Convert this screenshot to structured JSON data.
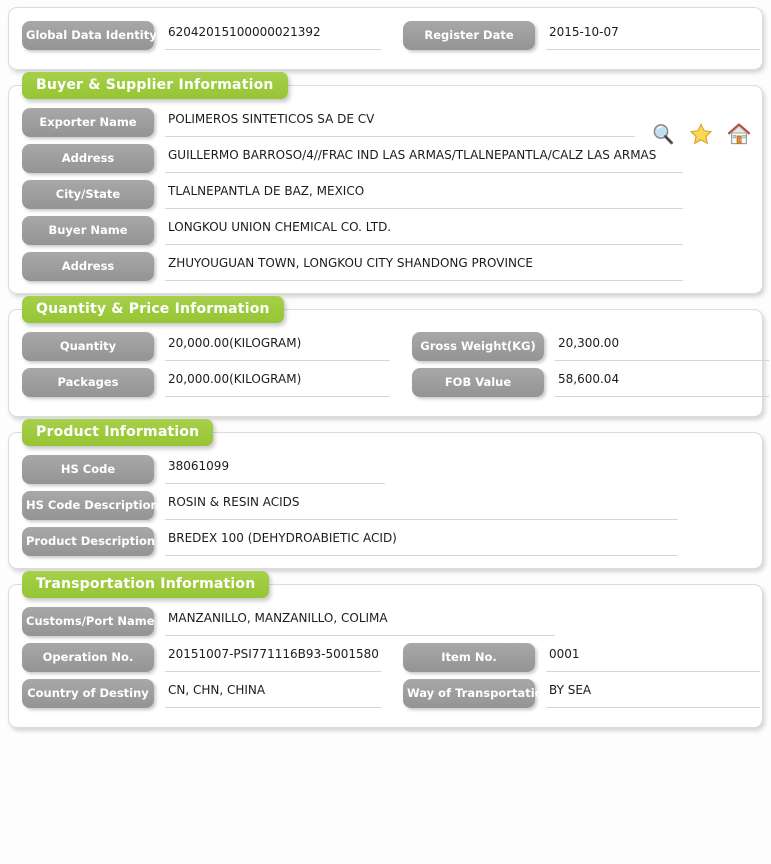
{
  "theme": {
    "section_green": "#9bc93c",
    "label_gray": "#9e9e9e",
    "panel_white": "#ffffff",
    "underline": "#d6d6d6",
    "text": "#1c1c1c"
  },
  "header_panel": {
    "fields": [
      {
        "label": "Global Data Identity",
        "value": "62042015100000021392"
      },
      {
        "label": "Register Date",
        "value": "2015-10-07"
      }
    ]
  },
  "buyer_supplier": {
    "title": "Buyer & Supplier Information",
    "fields": [
      {
        "label": "Exporter Name",
        "value": "POLIMEROS SINTETICOS SA DE CV"
      },
      {
        "label": "Address",
        "value": "GUILLERMO BARROSO/4//FRAC IND LAS ARMAS/TLALNEPANTLA/CALZ LAS ARMAS"
      },
      {
        "label": "City/State",
        "value": "TLALNEPANTLA DE BAZ, MEXICO"
      },
      {
        "label": "Buyer Name",
        "value": "LONGKOU UNION CHEMICAL CO. LTD."
      },
      {
        "label": "Address",
        "value": "ZHUYOUGUAN TOWN, LONGKOU CITY SHANDONG PROVINCE"
      }
    ],
    "actions": [
      {
        "name": "search-icon",
        "title": "Search"
      },
      {
        "name": "star-icon",
        "title": "Favorite"
      },
      {
        "name": "home-icon",
        "title": "Home"
      }
    ]
  },
  "quantity_price": {
    "title": "Quantity & Price Information",
    "fields": [
      {
        "label": "Quantity",
        "value": "20,000.00(KILOGRAM)"
      },
      {
        "label": "Gross Weight(KG)",
        "value": "20,300.00"
      },
      {
        "label": "Packages",
        "value": "20,000.00(KILOGRAM)"
      },
      {
        "label": "FOB Value",
        "value": "58,600.04"
      }
    ]
  },
  "product": {
    "title": "Product Information",
    "fields": [
      {
        "label": "HS Code",
        "value": "38061099"
      },
      {
        "label": "HS Code Description",
        "value": "ROSIN & RESIN ACIDS"
      },
      {
        "label": "Product Description",
        "value": "BREDEX 100 (DEHYDROABIETIC ACID)"
      }
    ]
  },
  "transportation": {
    "title": "Transportation Information",
    "fields": [
      {
        "label": "Customs/Port Name",
        "value": "MANZANILLO, MANZANILLO, COLIMA"
      },
      {
        "label": "Operation No.",
        "value": "20151007-PSI771116B93-5001580"
      },
      {
        "label": "Item No.",
        "value": "0001"
      },
      {
        "label": "Country of Destiny",
        "value": "CN, CHN, CHINA"
      },
      {
        "label": "Way of Transportation",
        "value": "BY SEA"
      }
    ]
  }
}
